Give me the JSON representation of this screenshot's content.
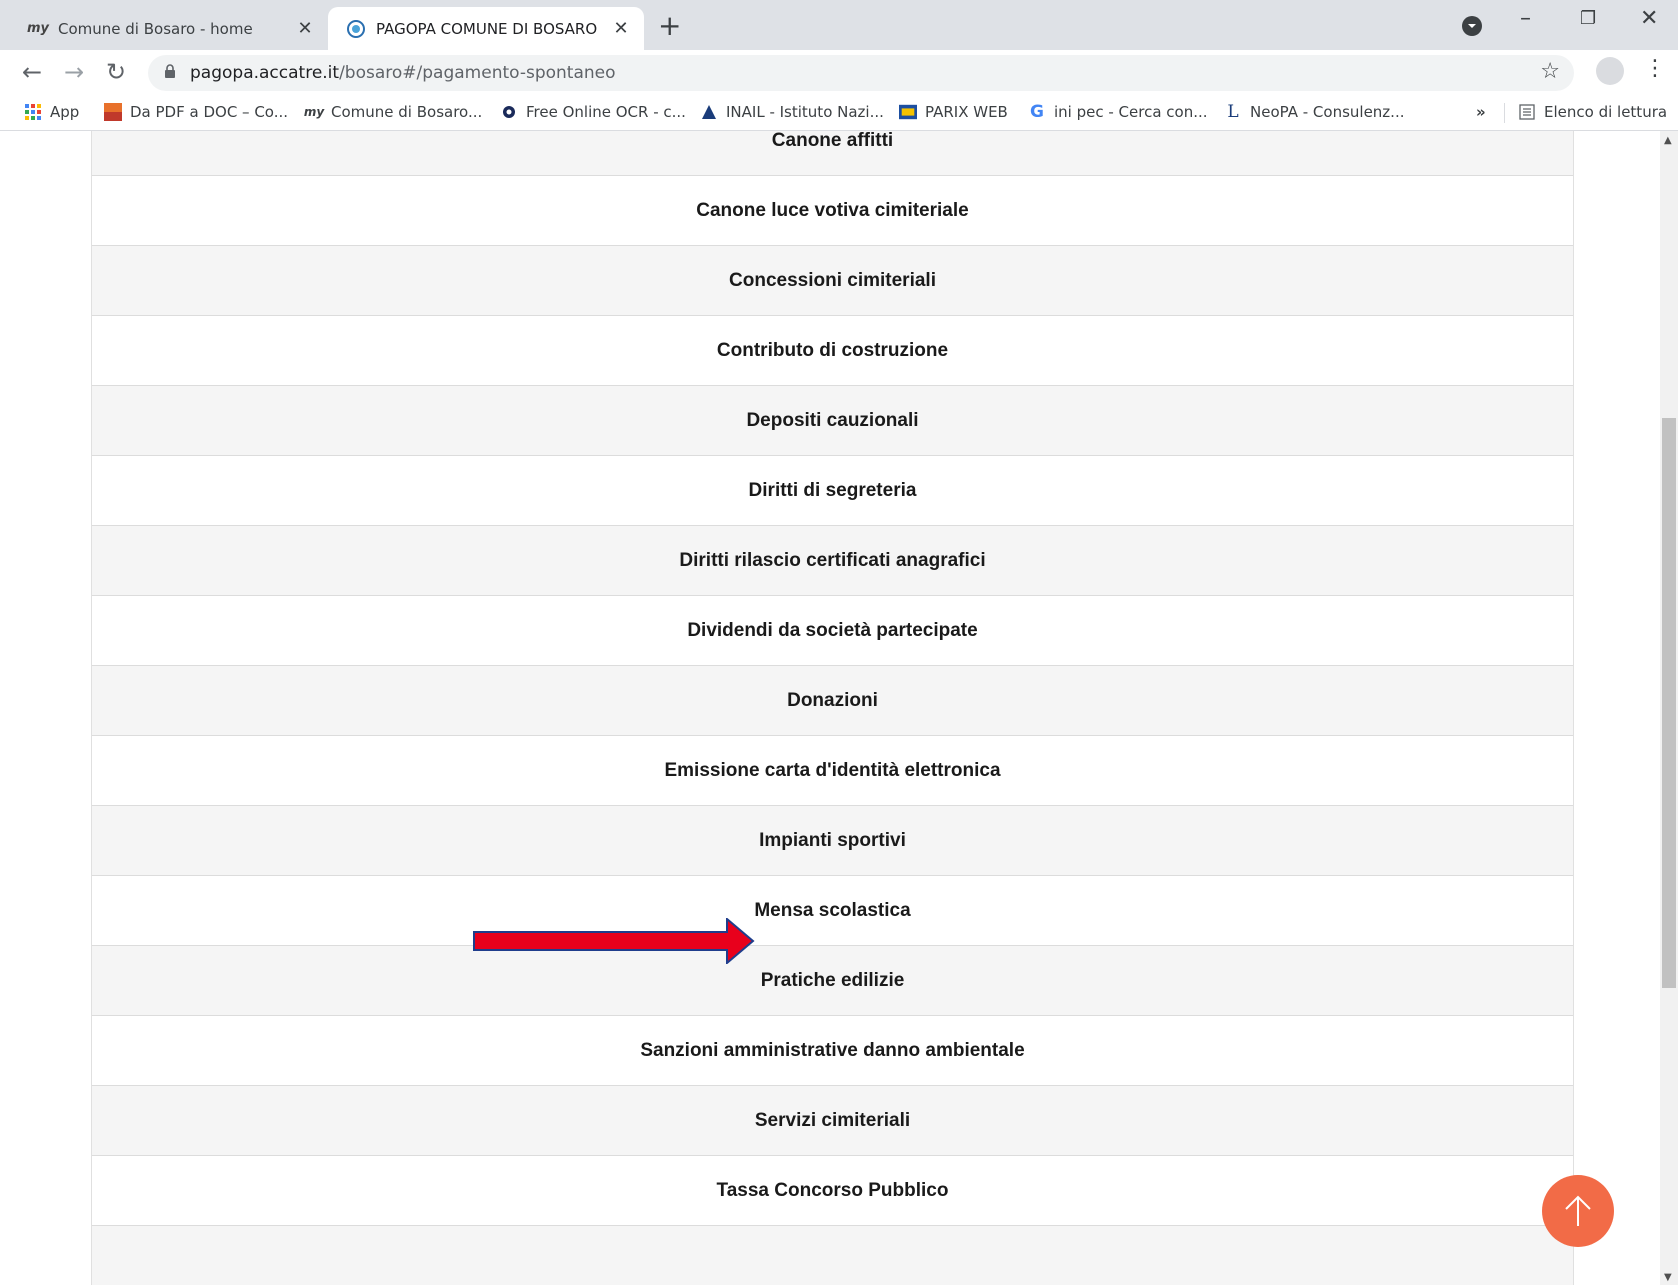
{
  "browser": {
    "tabs": [
      {
        "favicon": "my",
        "title": "Comune di Bosaro - home",
        "active": false
      },
      {
        "favicon": "pagopa-icon",
        "title": "PAGOPA COMUNE DI BOSARO",
        "active": true
      }
    ],
    "url_host": "pagopa.accatre.it",
    "url_path": "/bosaro#/pagamento-spontaneo"
  },
  "bookmarks": [
    {
      "icon": "apps-grid-icon",
      "label": "App"
    },
    {
      "icon": "pdf-doc-icon",
      "label": "Da PDF a DOC – Co..."
    },
    {
      "icon": "my",
      "label": "Comune di Bosaro..."
    },
    {
      "icon": "ocr-icon",
      "label": "Free Online OCR - c..."
    },
    {
      "icon": "inail-icon",
      "label": "INAIL - Istituto Nazi..."
    },
    {
      "icon": "parix-icon",
      "label": "PARIX WEB"
    },
    {
      "icon": "google-icon",
      "label": "ini pec - Cerca con..."
    },
    {
      "icon": "neopa-icon",
      "label": "NeoPA - Consulenz..."
    }
  ],
  "bookmarks_overflow": "»",
  "reading_list": "Elenco di lettura",
  "services": [
    "Canone affitti",
    "Canone luce votiva cimiteriale",
    "Concessioni cimiteriali",
    "Contributo di costruzione",
    "Depositi cauzionali",
    "Diritti di segreteria",
    "Diritti rilascio certificati anagrafici",
    "Dividendi da società partecipate",
    "Donazioni",
    "Emissione carta d'identità elettronica",
    "Impianti sportivi",
    "Mensa scolastica",
    "Pratiche edilizie",
    "Sanzioni amministrative danno ambientale",
    "Servizi cimiteriali",
    "Tassa Concorso Pubblico",
    ""
  ],
  "colors": {
    "arrow": "#e8001c",
    "arrow_outline": "#1f3d8c",
    "to_top": "#f26b47"
  }
}
